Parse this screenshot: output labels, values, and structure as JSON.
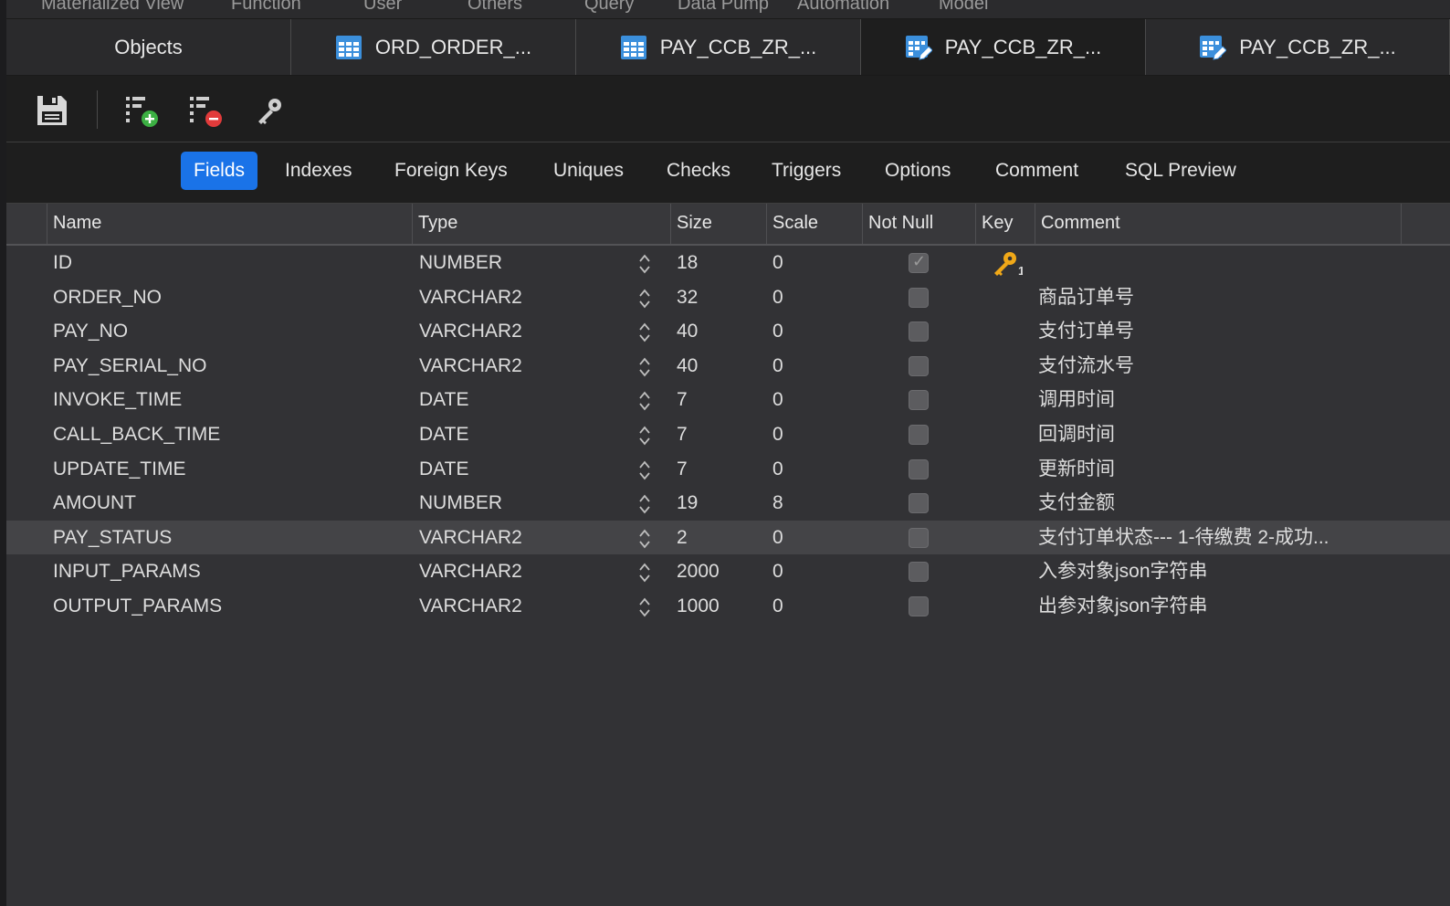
{
  "top_menu": [
    "Materialized View",
    "Function",
    "User",
    "Others",
    "Query",
    "Data Pump",
    "Automation",
    "Model"
  ],
  "tabs": [
    {
      "label": "Objects",
      "icon": "none"
    },
    {
      "label": "ORD_ORDER_...",
      "icon": "table-icon"
    },
    {
      "label": "PAY_CCB_ZR_...",
      "icon": "table-icon"
    },
    {
      "label": "PAY_CCB_ZR_...",
      "icon": "table-design-icon"
    },
    {
      "label": "PAY_CCB_ZR_...",
      "icon": "table-design-icon"
    }
  ],
  "active_tab": 3,
  "toolbar": {
    "icons": [
      "save-icon",
      "add-field-icon",
      "delete-field-icon",
      "primary-key-icon"
    ]
  },
  "subtabs": [
    "Fields",
    "Indexes",
    "Foreign Keys",
    "Uniques",
    "Checks",
    "Triggers",
    "Options",
    "Comment",
    "SQL Preview"
  ],
  "active_subtab": "Fields",
  "columns": [
    "Name",
    "Type",
    "Size",
    "Scale",
    "Not Null",
    "Key",
    "Comment"
  ],
  "fields": [
    {
      "name": "ID",
      "type": "NUMBER",
      "size": "18",
      "scale": "0",
      "not_null": true,
      "key": "1",
      "comment": ""
    },
    {
      "name": "ORDER_NO",
      "type": "VARCHAR2",
      "size": "32",
      "scale": "0",
      "not_null": false,
      "key": "",
      "comment": "商品订单号"
    },
    {
      "name": "PAY_NO",
      "type": "VARCHAR2",
      "size": "40",
      "scale": "0",
      "not_null": false,
      "key": "",
      "comment": "支付订单号"
    },
    {
      "name": "PAY_SERIAL_NO",
      "type": "VARCHAR2",
      "size": "40",
      "scale": "0",
      "not_null": false,
      "key": "",
      "comment": "支付流水号"
    },
    {
      "name": "INVOKE_TIME",
      "type": "DATE",
      "size": "7",
      "scale": "0",
      "not_null": false,
      "key": "",
      "comment": "调用时间"
    },
    {
      "name": "CALL_BACK_TIME",
      "type": "DATE",
      "size": "7",
      "scale": "0",
      "not_null": false,
      "key": "",
      "comment": "回调时间"
    },
    {
      "name": "UPDATE_TIME",
      "type": "DATE",
      "size": "7",
      "scale": "0",
      "not_null": false,
      "key": "",
      "comment": "更新时间"
    },
    {
      "name": "AMOUNT",
      "type": "NUMBER",
      "size": "19",
      "scale": "8",
      "not_null": false,
      "key": "",
      "comment": "支付金额"
    },
    {
      "name": "PAY_STATUS",
      "type": "VARCHAR2",
      "size": "2",
      "scale": "0",
      "not_null": false,
      "key": "",
      "comment": "支付订单状态--- 1-待缴费 2-成功..."
    },
    {
      "name": "INPUT_PARAMS",
      "type": "VARCHAR2",
      "size": "2000",
      "scale": "0",
      "not_null": false,
      "key": "",
      "comment": "入参对象json字符串"
    },
    {
      "name": "OUTPUT_PARAMS",
      "type": "VARCHAR2",
      "size": "1000",
      "scale": "0",
      "not_null": false,
      "key": "",
      "comment": "出参对象json字符串"
    }
  ],
  "selected_row": 8,
  "colors": {
    "accent": "#1a73e8",
    "key": "#f0a818",
    "add": "#3cb043",
    "remove": "#e23b3b"
  }
}
